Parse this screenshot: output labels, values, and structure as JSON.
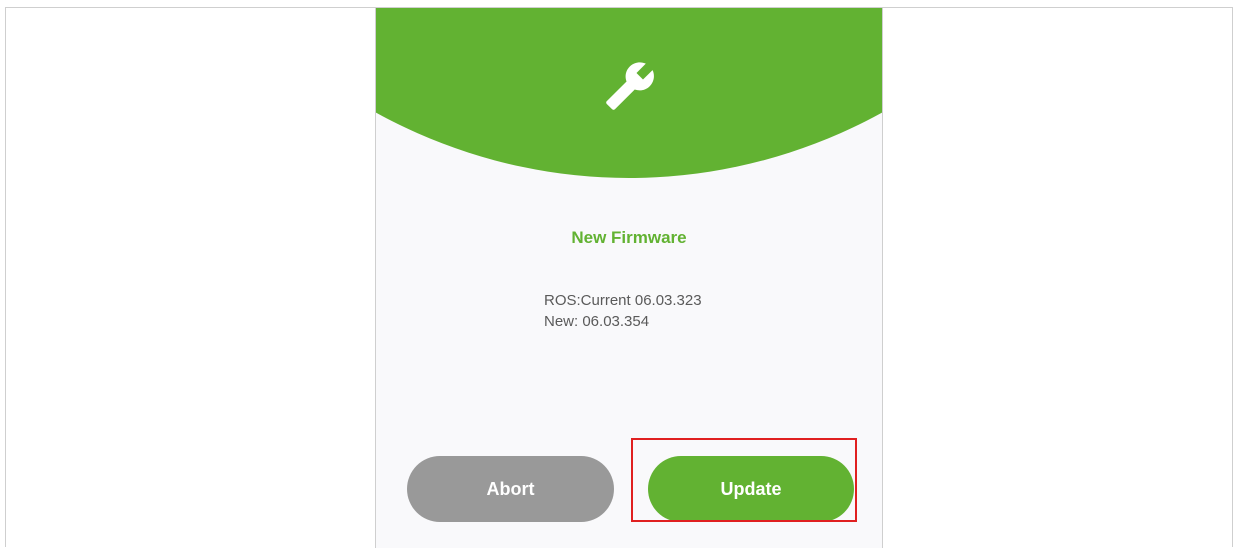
{
  "dialog": {
    "title": "New Firmware",
    "current_line": "ROS:Current 06.03.323",
    "new_line": "New: 06.03.354",
    "icon": "wrench-icon"
  },
  "buttons": {
    "abort_label": "Abort",
    "update_label": "Update"
  },
  "colors": {
    "brand_green": "#62b232",
    "abort_gray": "#999999",
    "highlight_red": "#e02020"
  }
}
